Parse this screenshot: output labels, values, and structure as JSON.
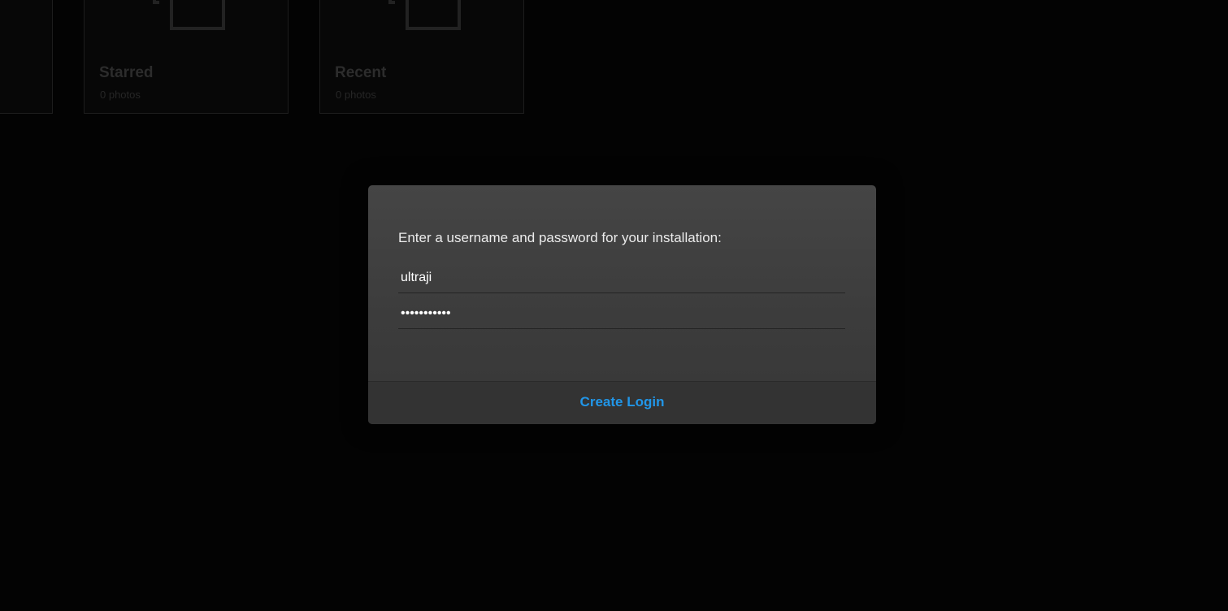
{
  "albums": [
    {
      "title": "",
      "count": ""
    },
    {
      "title": "Starred",
      "count": "0 photos"
    },
    {
      "title": "Recent",
      "count": "0 photos"
    }
  ],
  "dialog": {
    "message": "Enter a username and password for your installation:",
    "username_value": "ultraji",
    "password_value": "•••••••••••",
    "create_label": "Create Login"
  },
  "colors": {
    "accent": "#2196e8",
    "background": "#030303",
    "dialog": "#404040"
  },
  "icons": {
    "album_placeholder": "image-placeholder-icon"
  }
}
